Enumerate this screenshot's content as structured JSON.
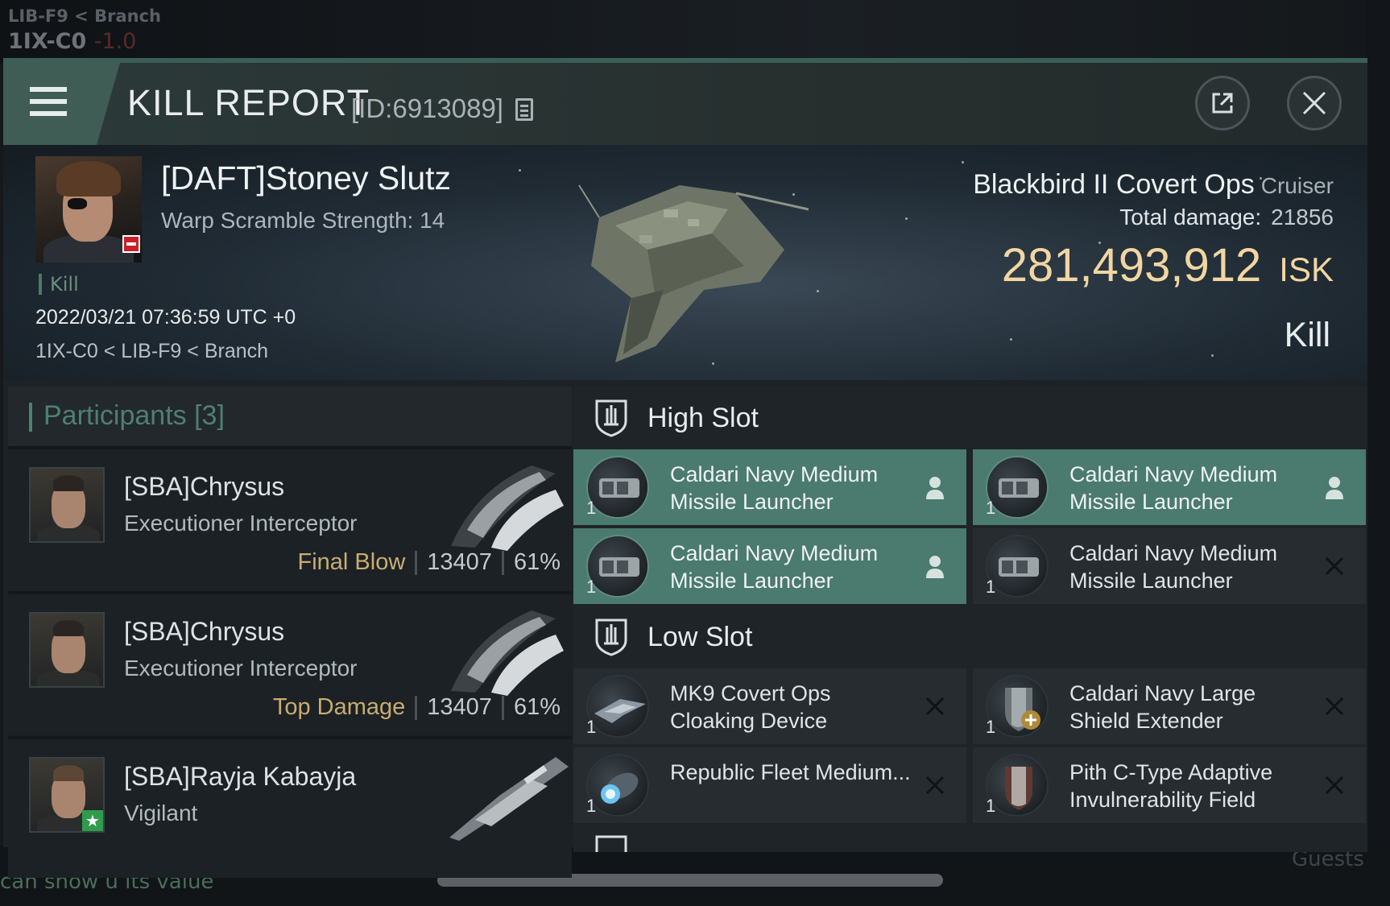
{
  "background": {
    "location_line1": "LIB-F9 < Branch",
    "location_system": "1IX-C0",
    "location_security": "-1.0",
    "chat_text": "can show u its value",
    "guests_label": "Guests"
  },
  "window": {
    "title": "KILL REPORT",
    "report_id": "[ID:6913089]"
  },
  "victim": {
    "name": "[DAFT]Stoney Slutz",
    "warp_scramble": "Warp Scramble Strength: 14",
    "tag": "Kill",
    "datetime": "2022/03/21 07:36:59 UTC +0",
    "location": "1IX-C0 < LIB-F9 < Branch"
  },
  "ship": {
    "name": "Blackbird II Covert Ops",
    "class": "Cruiser",
    "total_damage_label": "Total damage:",
    "total_damage": "21856",
    "isk_value": "281,493,912",
    "isk_unit": "ISK",
    "result": "Kill"
  },
  "participants": {
    "title": "Participants",
    "count": "[3]",
    "list": [
      {
        "name": "[SBA]Chrysus",
        "ship": "Executioner Interceptor",
        "tag": "Final Blow",
        "damage": "13407",
        "percent": "61%"
      },
      {
        "name": "[SBA]Chrysus",
        "ship": "Executioner Interceptor",
        "tag": "Top Damage",
        "damage": "13407",
        "percent": "61%"
      },
      {
        "name": "[SBA]Rayja Kabayja",
        "ship": "Vigilant"
      }
    ]
  },
  "slots": {
    "high": {
      "title": "High Slot",
      "modules": [
        {
          "name": "Caldari Navy Medium Missile Launcher",
          "qty": "1",
          "state": "pilot-icon"
        },
        {
          "name": "Caldari Navy Medium Missile Launcher",
          "qty": "1",
          "state": "pilot-icon"
        },
        {
          "name": "Caldari Navy Medium Missile Launcher",
          "qty": "1",
          "state": "pilot-icon"
        },
        {
          "name": "Caldari Navy Medium Missile Launcher",
          "qty": "1",
          "state": "destroyed-x-icon"
        }
      ]
    },
    "low": {
      "title": "Low Slot",
      "modules": [
        {
          "name": "MK9 Covert Ops Cloaking Device",
          "qty": "1",
          "state": "destroyed-x-icon"
        },
        {
          "name": "Caldari Navy Large Shield Extender",
          "qty": "1",
          "state": "destroyed-x-icon"
        },
        {
          "name": "Republic Fleet Medium...",
          "qty": "1",
          "state": "destroyed-x-icon"
        },
        {
          "name": "Pith C-Type Adaptive Invulnerability Field",
          "qty": "1",
          "state": "destroyed-x-icon"
        }
      ]
    }
  },
  "colors": {
    "accent": "#4b7a6e",
    "isk_gold": "#f1d6a2",
    "tag_gold": "#c8ad71"
  }
}
